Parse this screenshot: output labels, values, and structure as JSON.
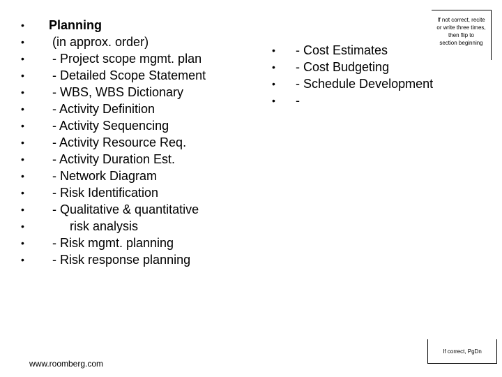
{
  "left_list": [
    {
      "text": "Planning",
      "heading": true
    },
    {
      "text": " (in approx. order)"
    },
    {
      "text": " - Project scope mgmt. plan"
    },
    {
      "text": " - Detailed Scope Statement"
    },
    {
      "text": " - WBS, WBS Dictionary"
    },
    {
      "text": " - Activity Definition"
    },
    {
      "text": " - Activity Sequencing"
    },
    {
      "text": " - Activity Resource Req."
    },
    {
      "text": " - Activity Duration Est."
    },
    {
      "text": " - Network Diagram"
    },
    {
      "text": " - Risk Identification"
    },
    {
      "text": " - Qualitative & quantitative"
    },
    {
      "text": "      risk analysis"
    },
    {
      "text": " - Risk mgmt. planning"
    },
    {
      "text": " - Risk response planning"
    }
  ],
  "right_list": [
    {
      "text": "- Cost Estimates"
    },
    {
      "text": "- Cost Budgeting"
    },
    {
      "text": "- Schedule Development"
    },
    {
      "text": "-"
    }
  ],
  "bullet_glyph": "•",
  "notes": {
    "top_lines": [
      "If not correct, recite",
      "or write three times,",
      "then flip to",
      "section beginning"
    ],
    "bottom": "If correct, PgDn"
  },
  "footer": "www.roomberg.com"
}
